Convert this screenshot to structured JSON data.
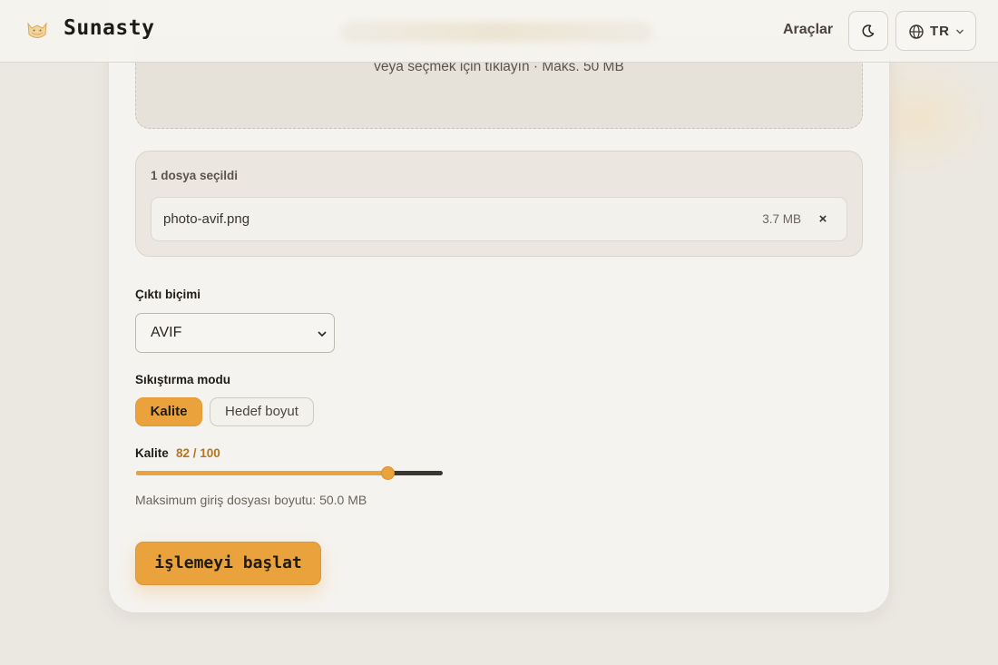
{
  "header": {
    "brand": "Sunasty",
    "nav_tools": "Araçlar",
    "lang_code": "TR"
  },
  "upload": {
    "hint": "veya seçmek için tıklayın · Maks. 50 MB"
  },
  "files": {
    "count_label": "1 dosya seçildi",
    "items": [
      {
        "name": "photo-avif.png",
        "size": "3.7 MB",
        "remove": "×"
      }
    ]
  },
  "output": {
    "label": "Çıktı biçimi",
    "selected": "AVIF"
  },
  "compression": {
    "label": "Sıkıştırma modu",
    "modes": [
      "Kalite",
      "Hedef boyut"
    ],
    "active": "Kalite"
  },
  "quality": {
    "label": "Kalite",
    "value_text": "82 / 100",
    "value": 82,
    "max": 100
  },
  "max_input": "Maksimum giriş dosyası boyutu: 50.0 MB",
  "start_button": "işlemeyi başlat",
  "colors": {
    "accent": "#e9a23c",
    "accent_text": "#b5761e",
    "background": "#ebe8e2",
    "card": "#f5f3ef"
  },
  "icons": {
    "logo": "fox-logo-icon",
    "theme": "moon-icon",
    "language": "globe-icon",
    "language_dropdown": "chevron-down-icon",
    "select_dropdown": "chevron-down-icon",
    "remove_file": "close-icon"
  }
}
